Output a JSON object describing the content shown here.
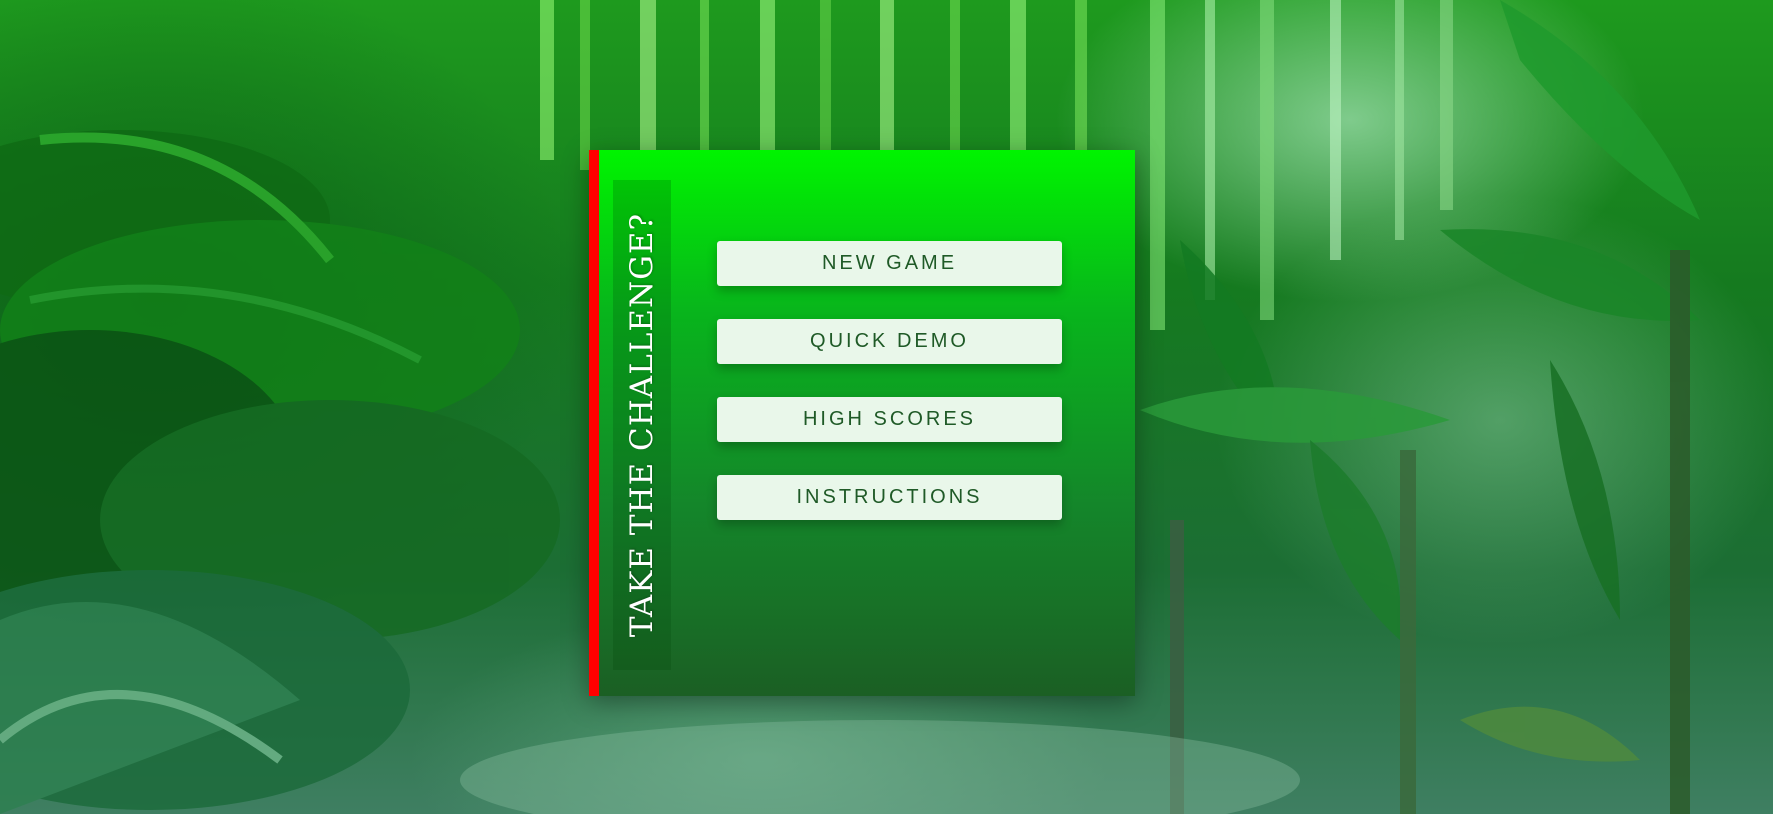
{
  "colors": {
    "panel_accent": "#ff0000",
    "panel_top": "#00f400",
    "panel_bottom": "#1b5f24",
    "button_bg": "#e9f7ea",
    "button_text": "#1f5a27"
  },
  "menu": {
    "title": "TAKE THE CHALLENGE?",
    "buttons": [
      {
        "label": "NEW GAME"
      },
      {
        "label": "QUICK DEMO"
      },
      {
        "label": "HIGH SCORES"
      },
      {
        "label": "INSTRUCTIONS"
      }
    ]
  }
}
